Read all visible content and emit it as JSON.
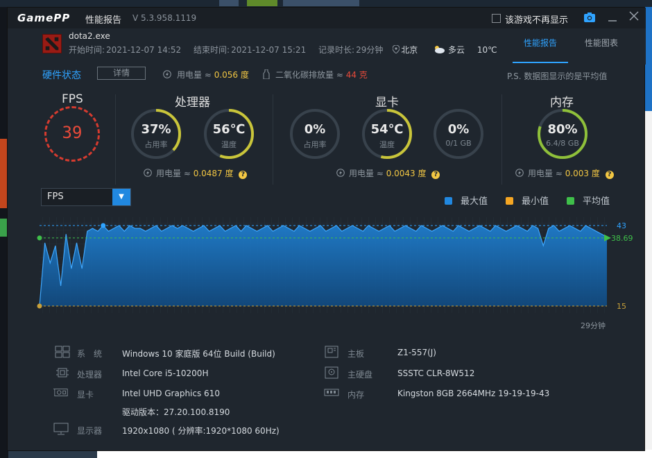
{
  "app": {
    "logo": "GamePP",
    "title": "性能报告",
    "version": "V 5.3.958.1119",
    "no_more_label": "该游戏不再显示"
  },
  "game": {
    "name": "dota2.exe",
    "start_label": "开始时间:",
    "start_value": "2021-12-07 14:52",
    "end_label": "结束时间:",
    "end_value": "2021-12-07 15:21",
    "duration_label": "记录时长:",
    "duration_value": "29分钟",
    "location": "北京",
    "weather": "多云",
    "temperature": "10℃"
  },
  "tabs": [
    {
      "label": "性能报告",
      "active": true
    },
    {
      "label": "性能图表",
      "active": false
    }
  ],
  "hardware": {
    "title": "硬件状态",
    "detail_button": "详情",
    "power_label": "用电量 ≈ ",
    "power_value": "0.056 度",
    "co2_label": "二氧化碳排放量 ≈ ",
    "co2_value": "44 克",
    "note": "P.S. 数据图显示的是平均值"
  },
  "fps": {
    "title": "FPS",
    "value": "39"
  },
  "cpu": {
    "title": "处理器",
    "usage": {
      "value": "37%",
      "label": "占用率",
      "fraction": 0.37
    },
    "temp": {
      "value": "56℃",
      "label": "温度",
      "fraction": 0.56
    },
    "power_label": "用电量 ≈ ",
    "power_value": "0.0487 度"
  },
  "gpu": {
    "title": "显卡",
    "usage": {
      "value": "0%",
      "label": "占用率",
      "fraction": 0
    },
    "temp": {
      "value": "54℃",
      "label": "温度",
      "fraction": 0.54
    },
    "vram": {
      "value": "0%",
      "label": "0/1 GB",
      "fraction": 0
    },
    "power_label": "用电量 ≈ ",
    "power_value": "0.0043 度"
  },
  "memory": {
    "title": "内存",
    "usage": {
      "value": "80%",
      "label": "6.4/8 GB",
      "fraction": 0.8
    },
    "power_label": "用电量 ≈ ",
    "power_value": "0.003 度"
  },
  "chart_selector": {
    "selected": "FPS"
  },
  "legend": [
    {
      "name": "最大值",
      "color": "#2188e0"
    },
    {
      "name": "最小值",
      "color": "#f5a623"
    },
    {
      "name": "平均值",
      "color": "#3fbf4a"
    }
  ],
  "chart_data": {
    "type": "area",
    "series": [
      {
        "name": "FPS",
        "values": [
          15,
          37,
          30,
          36,
          22,
          40,
          28,
          37,
          28,
          41,
          42,
          41,
          43,
          41,
          42,
          43,
          41,
          43,
          42,
          42,
          41,
          42,
          43,
          41,
          42,
          43,
          42,
          43,
          42,
          41,
          42,
          43,
          41,
          42,
          43,
          41,
          42,
          43,
          41,
          43,
          42,
          41,
          42,
          43,
          41,
          42,
          43,
          42,
          41,
          43,
          42,
          41,
          42,
          43,
          41,
          42,
          43,
          41,
          42,
          43,
          42,
          41,
          43,
          42,
          41,
          42,
          43,
          41,
          42,
          43,
          42,
          41,
          43,
          42,
          41,
          42,
          43,
          42,
          41,
          43,
          42,
          41,
          42,
          43,
          42,
          41,
          43,
          42,
          41,
          42,
          43,
          42,
          41,
          43,
          42,
          36,
          42,
          43,
          41,
          42,
          43,
          42,
          41,
          43,
          42,
          41,
          40,
          39
        ]
      }
    ],
    "max_value": "43",
    "avg_value": "38.69",
    "min_value": "15",
    "ylim": [
      15,
      43
    ],
    "x_end_label": "29分钟"
  },
  "specs": {
    "system_label": "系　统",
    "system_value": "Windows 10 家庭版 64位   Build (Build)",
    "cpu_label": "处理器",
    "cpu_value": "Intel Core i5-10200H",
    "gpu_label": "显卡",
    "gpu_value": "Intel UHD Graphics 610",
    "driver_value": "驱动版本：27.20.100.8190",
    "display_label": "显示器",
    "display_value": "1920x1080 ( 分辨率:1920*1080 60Hz)",
    "board_label": "主板",
    "board_value": "Z1-557(J)",
    "disk_label": "主硬盘",
    "disk_value": "SSSTC CLR-8W512",
    "mem_label": "内存",
    "mem_value": "Kingston 8GB 2664MHz 19-19-19-43"
  },
  "colors": {
    "accent": "#2fa3ff",
    "fps_red": "#e84a3a",
    "ring_yellow": "#c9c53a",
    "ring_green": "#3fbf4a",
    "energy_yellow": "#f3c743"
  }
}
